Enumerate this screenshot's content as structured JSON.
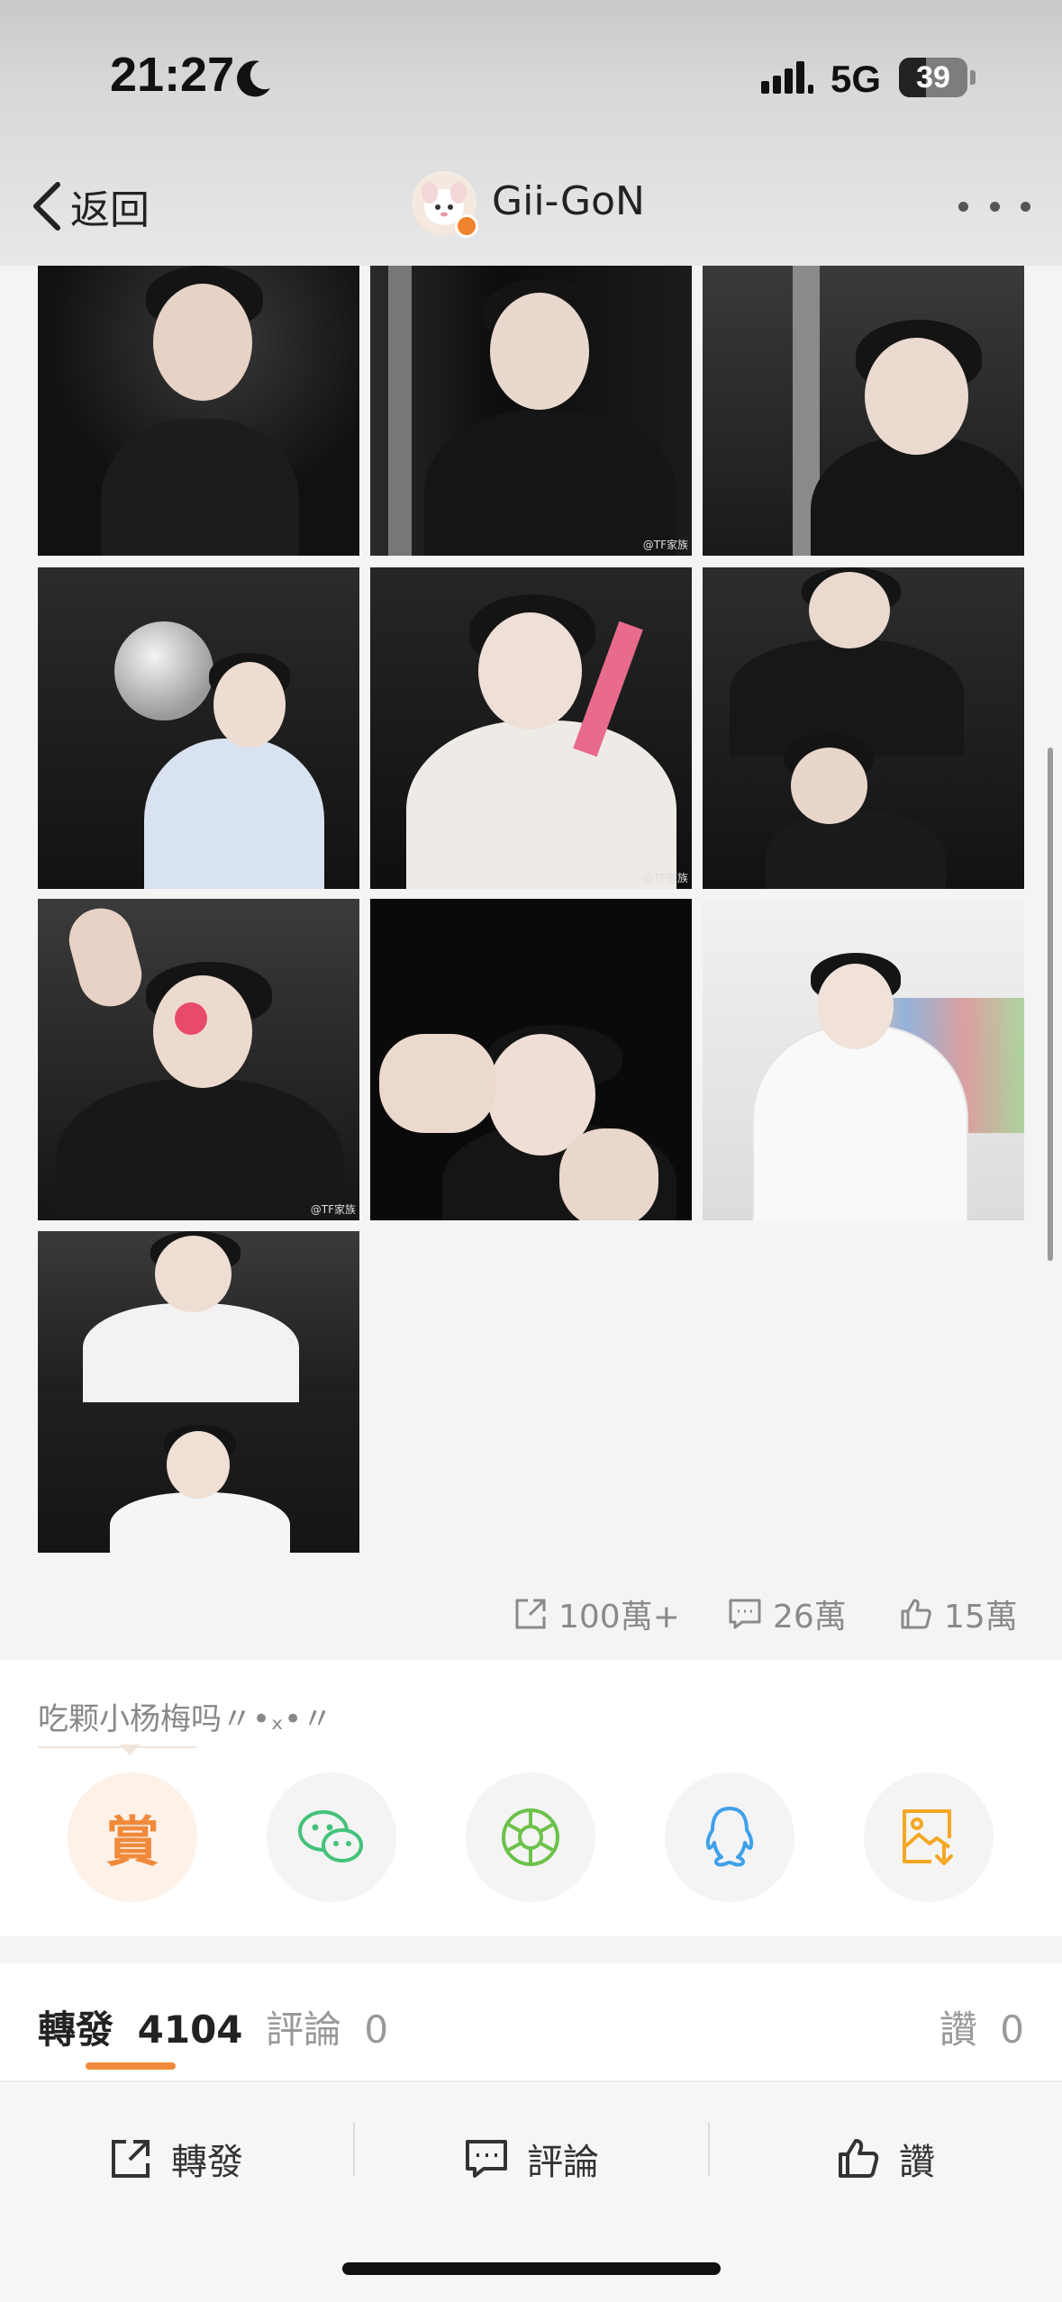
{
  "status_bar": {
    "time": "21:27",
    "network": "5G",
    "battery": "39",
    "battery_level": 0.39
  },
  "nav": {
    "back_label": "返回",
    "profile_name": "Gii-GoN"
  },
  "photo_watermark": "@TF家族",
  "stats": {
    "reposts": "100萬+",
    "comments": "26萬",
    "likes": "15萬"
  },
  "share": {
    "prompt": "吃颗小杨梅吗〃•ₓ•〃",
    "reward_label": "賞"
  },
  "tabs": {
    "reposts_label": "轉發",
    "reposts_count": "4104",
    "comments_label": "評論",
    "comments_count": "0",
    "likes_label": "讚",
    "likes_count": "0"
  },
  "actions": {
    "repost": "轉發",
    "comment": "評論",
    "like": "讚"
  },
  "colors": {
    "accent": "#f08a3a",
    "wechat": "#43c27a",
    "moments": "#6cc24a",
    "qq": "#3ea1ea",
    "save": "#f5a623"
  }
}
